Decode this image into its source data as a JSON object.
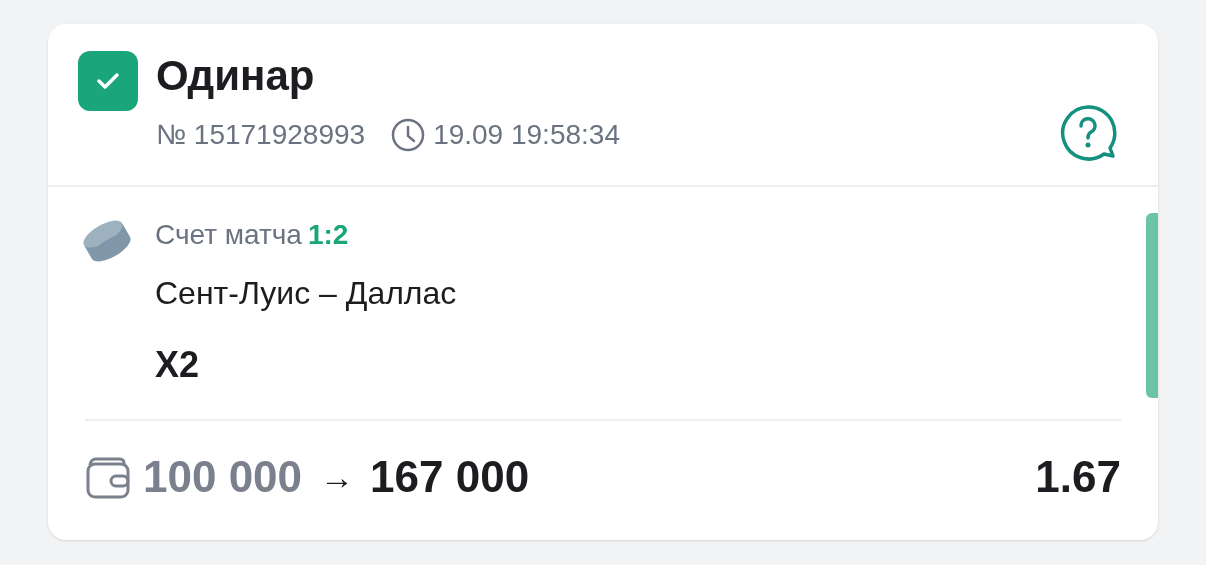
{
  "bet": {
    "checked": true,
    "title": "Одинар",
    "number": "№ 15171928993",
    "time": "19.09 19:58:34"
  },
  "event": {
    "score_label": "Счет матча",
    "score": "1:2",
    "teams": "Сент-Луис – Даллас",
    "outcome": "X2"
  },
  "footer": {
    "stake": "100 000",
    "arrow": "→",
    "payout": "167 000",
    "odds": "1.67"
  }
}
